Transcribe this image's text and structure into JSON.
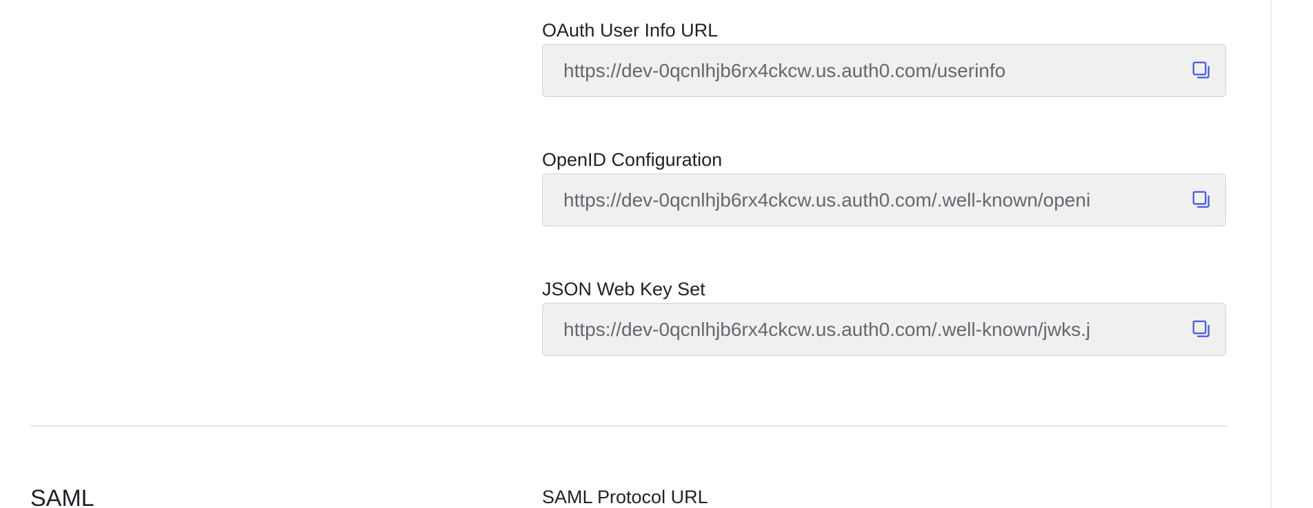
{
  "endpoints": [
    {
      "label": "OAuth User Info URL",
      "value": "https://dev-0qcnlhjb6rx4ckcw.us.auth0.com/userinfo",
      "copy_icon": "copy-icon"
    },
    {
      "label": "OpenID Configuration",
      "value": "https://dev-0qcnlhjb6rx4ckcw.us.auth0.com/.well-known/openi",
      "copy_icon": "copy-icon"
    },
    {
      "label": "JSON Web Key Set",
      "value": "https://dev-0qcnlhjb6rx4ckcw.us.auth0.com/.well-known/jwks.j",
      "copy_icon": "copy-icon"
    }
  ],
  "saml_section": {
    "title": "SAML",
    "first_field_label": "SAML Protocol URL"
  },
  "colors": {
    "accent": "#3f59e4",
    "field_bg": "#f0f0f0",
    "field_text": "#65676e",
    "label_text": "#1e212a",
    "divider": "#e3e4e8"
  }
}
